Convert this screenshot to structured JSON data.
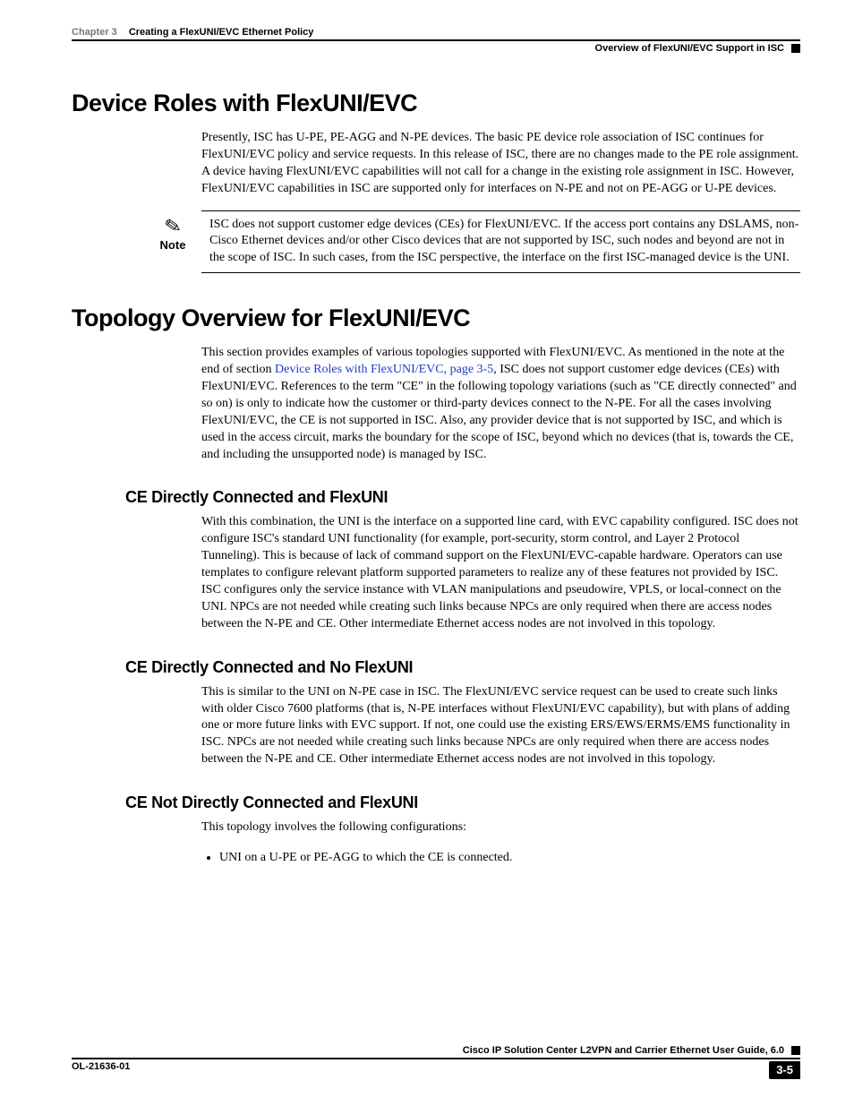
{
  "header": {
    "chapter_label": "Chapter 3",
    "chapter_title": "Creating a FlexUNI/EVC Ethernet Policy",
    "section_right": "Overview of FlexUNI/EVC Support in ISC"
  },
  "sections": {
    "s1": {
      "title": "Device Roles with FlexUNI/EVC",
      "p1": "Presently, ISC has U-PE, PE-AGG and N-PE devices. The basic PE device role association of ISC continues for FlexUNI/EVC policy and service requests. In this release of ISC, there are no changes made to the PE role assignment. A device having FlexUNI/EVC capabilities will not call for a change in the existing role assignment in ISC. However, FlexUNI/EVC capabilities in ISC are supported only for interfaces on N-PE and not on PE-AGG or U-PE devices.",
      "note_label": "Note",
      "note_text": "ISC does not support customer edge devices (CEs) for FlexUNI/EVC. If the access port contains any DSLAMS, non-Cisco Ethernet devices and/or other Cisco devices that are not supported by ISC, such nodes and beyond are not in the scope of ISC. In such cases, from the ISC perspective, the interface on the first ISC-managed device is the UNI."
    },
    "s2": {
      "title": "Topology Overview for FlexUNI/EVC",
      "p1a": "This section provides examples of various topologies supported with FlexUNI/EVC. As mentioned in the note at the end of section ",
      "xref": "Device Roles with FlexUNI/EVC, page 3-5",
      "p1b": ", ISC does not support customer edge devices (CEs) with FlexUNI/EVC. References to the term \"CE\" in the following topology variations (such as \"CE directly connected\" and so on) is only to indicate how the customer or third-party devices connect to the N-PE. For all the cases involving FlexUNI/EVC, the CE is not supported in ISC. Also, any provider device that is not supported by ISC, and which is used in the access circuit, marks the boundary for the scope of ISC, beyond which no devices (that is, towards the CE, and including the unsupported node) is managed by ISC.",
      "sub1": {
        "title": "CE Directly Connected and FlexUNI",
        "p": "With this combination, the UNI is the interface on a supported line card, with EVC capability configured. ISC does not configure ISC's standard UNI functionality (for example, port-security, storm control, and Layer 2 Protocol Tunneling). This is because of lack of command support on the FlexUNI/EVC-capable hardware. Operators can use templates to configure relevant platform supported parameters to realize any of these features not provided by ISC. ISC configures only the service instance with VLAN manipulations and pseudowire, VPLS, or local-connect on the UNI. NPCs are not needed while creating such links because NPCs are only required when there are access nodes between the N-PE and CE. Other intermediate Ethernet access nodes are not involved in this topology."
      },
      "sub2": {
        "title": "CE Directly Connected and No FlexUNI",
        "p": "This is similar to the UNI on N-PE case in ISC. The FlexUNI/EVC service request can be used to create such links with older Cisco 7600 platforms (that is, N-PE interfaces without FlexUNI/EVC capability), but with plans of adding one or more future links with EVC support. If not, one could use the existing ERS/EWS/ERMS/EMS functionality in ISC. NPCs are not needed while creating such links because NPCs are only required when there are access nodes between the N-PE and CE. Other intermediate Ethernet access nodes are not involved in this topology."
      },
      "sub3": {
        "title": "CE Not Directly Connected and FlexUNI",
        "p": "This topology involves the following configurations:",
        "bullet1": "UNI on a U-PE or PE-AGG to which the CE is connected."
      }
    }
  },
  "footer": {
    "guide_title": "Cisco IP Solution Center L2VPN and Carrier Ethernet User Guide, 6.0",
    "doc_id": "OL-21636-01",
    "page_number": "3-5"
  }
}
